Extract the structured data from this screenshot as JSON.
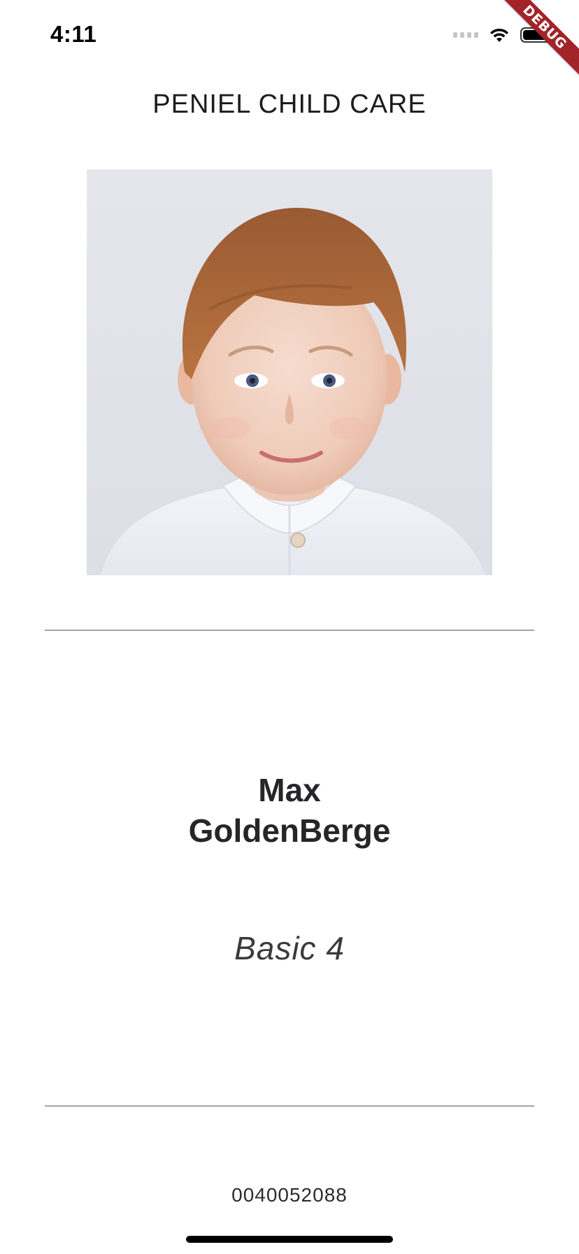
{
  "status_bar": {
    "time": "4:11",
    "icons": [
      "cellular-signal-icon",
      "wifi-icon",
      "battery-icon"
    ]
  },
  "debug_banner": {
    "label": "DEBUG",
    "color": "#a3232b"
  },
  "header": {
    "title": "PENIEL CHILD CARE"
  },
  "student": {
    "photo": "child-portrait",
    "first_name": "Max",
    "last_name": "GoldenBerge",
    "class": "Basic 4",
    "id_number": "0040052088"
  }
}
